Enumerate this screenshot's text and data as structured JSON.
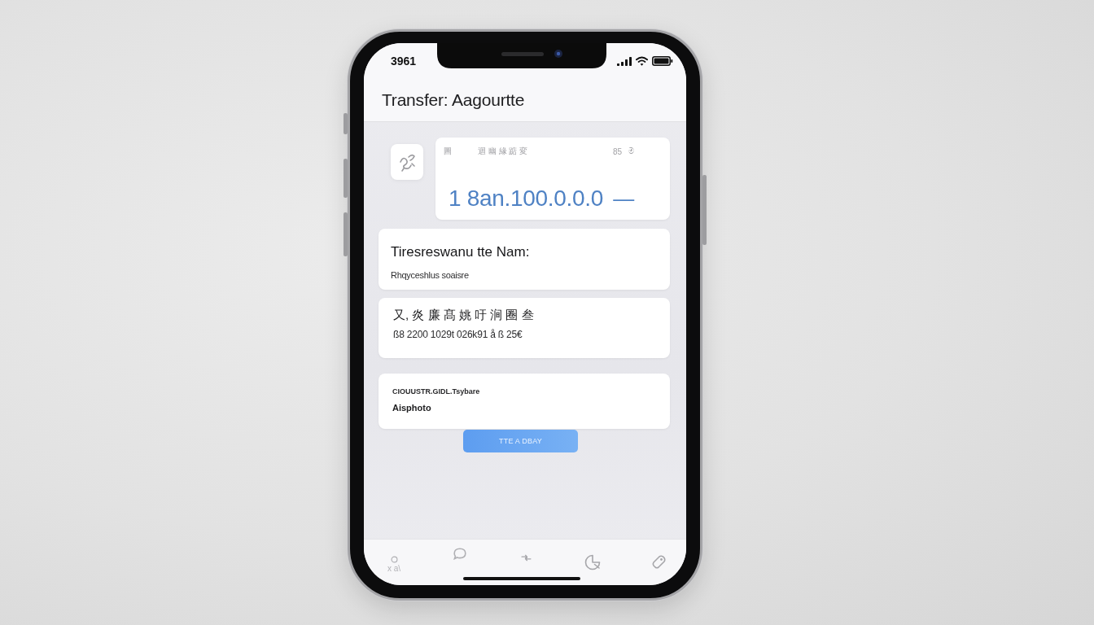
{
  "status_bar": {
    "time": "3961"
  },
  "header": {
    "title": "Transfer: Aagourtte"
  },
  "amount_card": {
    "labels": [
      "圖",
      "迴 幽 緣 踮 変",
      "85",
      "ම"
    ],
    "amount": "1 8an.100.0.0.0",
    "suffix": "—"
  },
  "recipient_card": {
    "name": "Tiresreswanu tte Nam:",
    "detail": "Rhqyceshlus soaisre"
  },
  "account_card": {
    "name": "又, 炎 廉 髙 姚 吁 涧 圈 叁",
    "number": "ß8 2200 1029t 026k91 å ß 25€"
  },
  "note_card": {
    "label": "CIOUUSTR.GIDL.Tsybare",
    "value": "Aisphoto"
  },
  "button": {
    "label": "TTE A DBAY"
  },
  "tab_bar": {
    "items": [
      {
        "kind": "person",
        "label": "x a\\"
      },
      {
        "kind": "bubble"
      },
      {
        "kind": "arrows"
      },
      {
        "kind": "pie"
      },
      {
        "kind": "tag"
      }
    ]
  }
}
